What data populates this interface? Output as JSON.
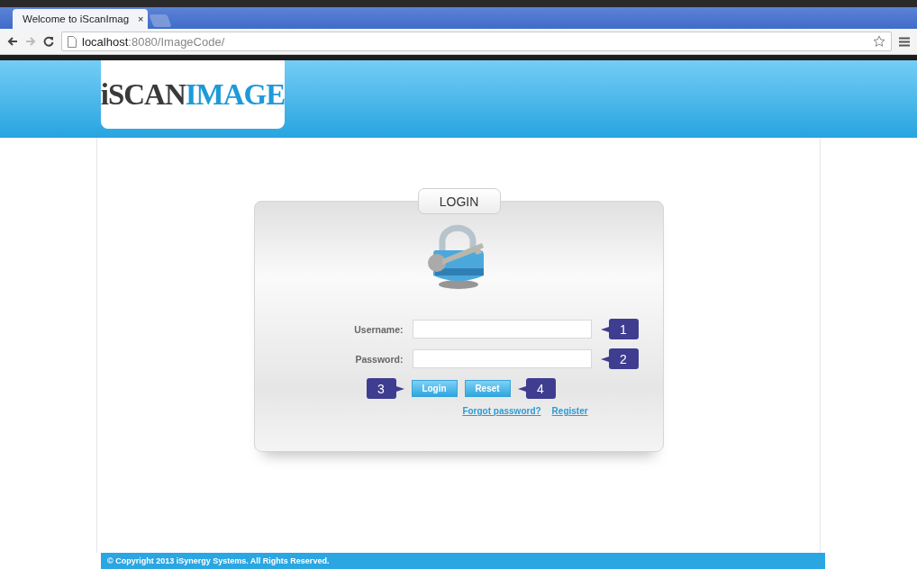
{
  "browser": {
    "tab_title": "Welcome to iScanImag",
    "tab_close": "×",
    "url_host": "localhost",
    "url_path": ":8080/ImageCode/"
  },
  "logo": {
    "dark_part": "iSCAN",
    "blue_part": "IMAGE"
  },
  "login": {
    "title": "LOGIN",
    "fields": [
      {
        "label": "Username:",
        "callout": "1"
      },
      {
        "label": "Password:",
        "callout": "2"
      }
    ],
    "button_row": [
      {
        "kind": "callout",
        "text": "3"
      },
      {
        "kind": "button",
        "text": "Login"
      },
      {
        "kind": "button",
        "text": "Reset"
      },
      {
        "kind": "callout",
        "text": "4"
      }
    ],
    "links": [
      "Forgot password?",
      "Register"
    ]
  },
  "footer": "© Copyright 2013 iSynergy Systems. All Rights Reserved."
}
